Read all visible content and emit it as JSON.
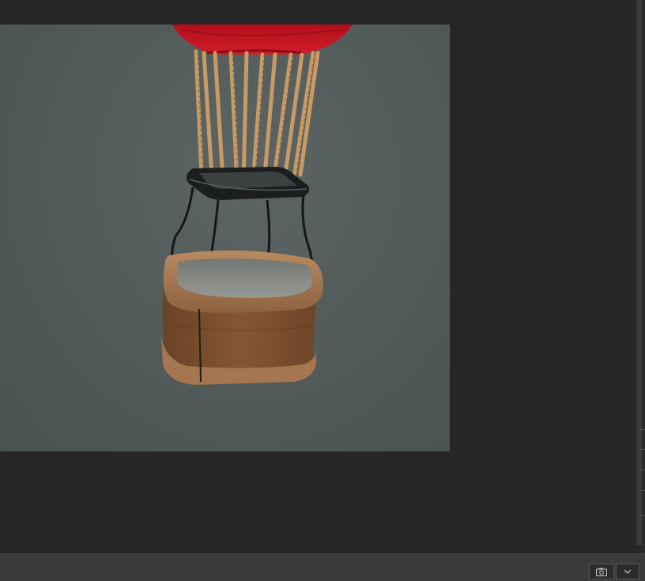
{
  "viewport": {
    "background_color": "#262626",
    "render_background_color": "#535c5b"
  },
  "render": {
    "subject": "hot-air-balloon-basket",
    "balloon_color": "#c0141e",
    "rope_color": "#c99a63",
    "frame_color": "#1b1d1f",
    "basket_color": "#7a4f2e",
    "basket_rim_color": "#a97952"
  },
  "toolbar": {
    "snapshot_icon": "camera-icon",
    "menu_icon": "chevron-down-icon"
  }
}
